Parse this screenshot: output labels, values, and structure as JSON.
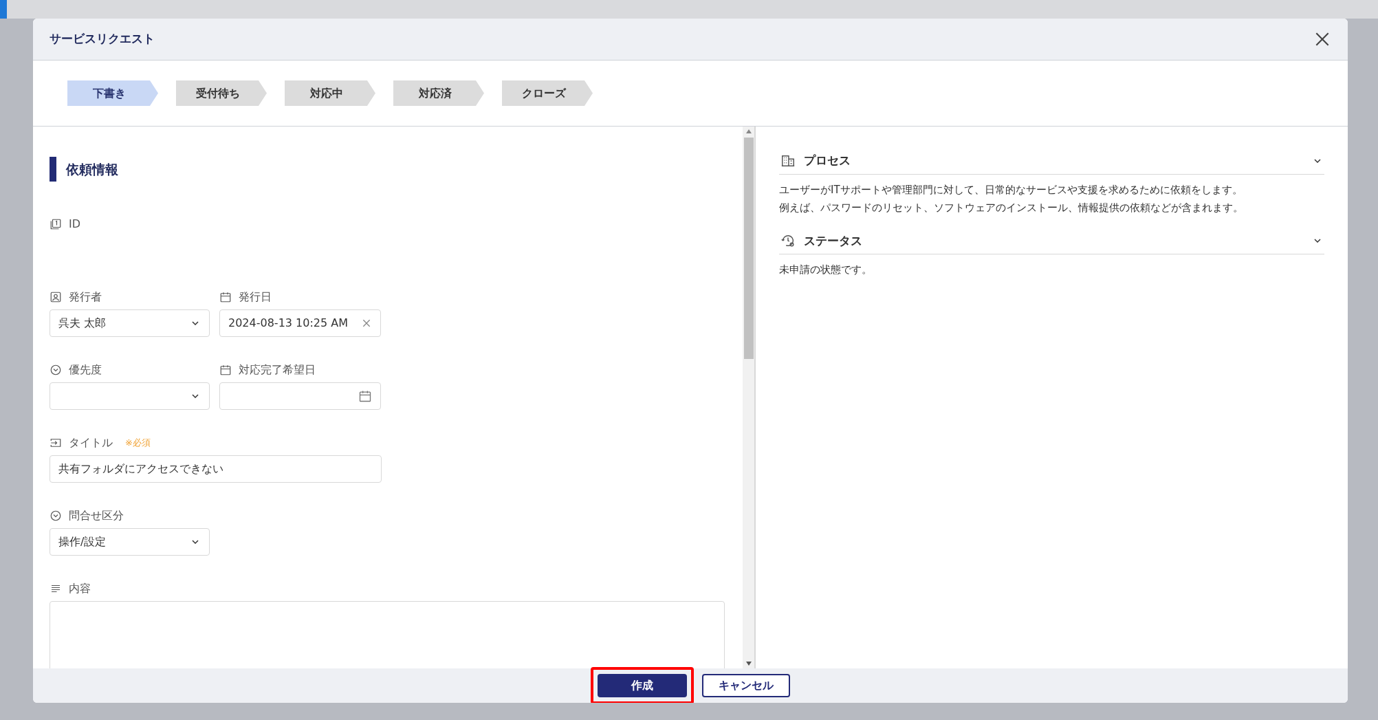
{
  "dialog": {
    "title": "サービスリクエスト"
  },
  "steps": [
    {
      "label": "下書き",
      "selected": true
    },
    {
      "label": "受付待ち",
      "selected": false
    },
    {
      "label": "対応中",
      "selected": false
    },
    {
      "label": "対応済",
      "selected": false
    },
    {
      "label": "クローズ",
      "selected": false
    }
  ],
  "section": {
    "title": "依頼情報"
  },
  "rows": [
    [
      {
        "kind": "readonly",
        "label": "ID"
      }
    ],
    [
      {
        "kind": "select",
        "label": "発行者",
        "value": "呉夫 太郎"
      },
      {
        "kind": "datetime",
        "label": "発行日",
        "value": "2024-08-13 10:25 AM"
      }
    ],
    [
      {
        "kind": "select",
        "label": "優先度"
      },
      {
        "kind": "date",
        "label": "対応完了希望日"
      }
    ],
    [
      {
        "kind": "text",
        "label": "タイトル",
        "required_note": "※必須",
        "value": "共有フォルダにアクセスできない"
      }
    ],
    [
      {
        "kind": "select",
        "label": "問合せ区分",
        "value": "操作/設定"
      }
    ],
    [
      {
        "kind": "textarea",
        "label": "内容"
      }
    ]
  ],
  "side_panels": [
    {
      "title": "プロセス",
      "expanded": true,
      "lines": [
        "ユーザーがITサポートや管理部門に対して、日常的なサービスや支援を求めるために依頼をします。",
        "例えば、パスワードのリセット、ソフトウェアのインストール、情報提供の依頼などが含まれます。"
      ]
    },
    {
      "title": "ステータス",
      "expanded": true,
      "lines": [
        "未申請の状態です。"
      ]
    }
  ],
  "buttons": [
    {
      "label": "作成",
      "kind": "primary",
      "highlighted": true
    },
    {
      "label": "キャンセル",
      "kind": "secondary",
      "highlighted": false
    }
  ]
}
